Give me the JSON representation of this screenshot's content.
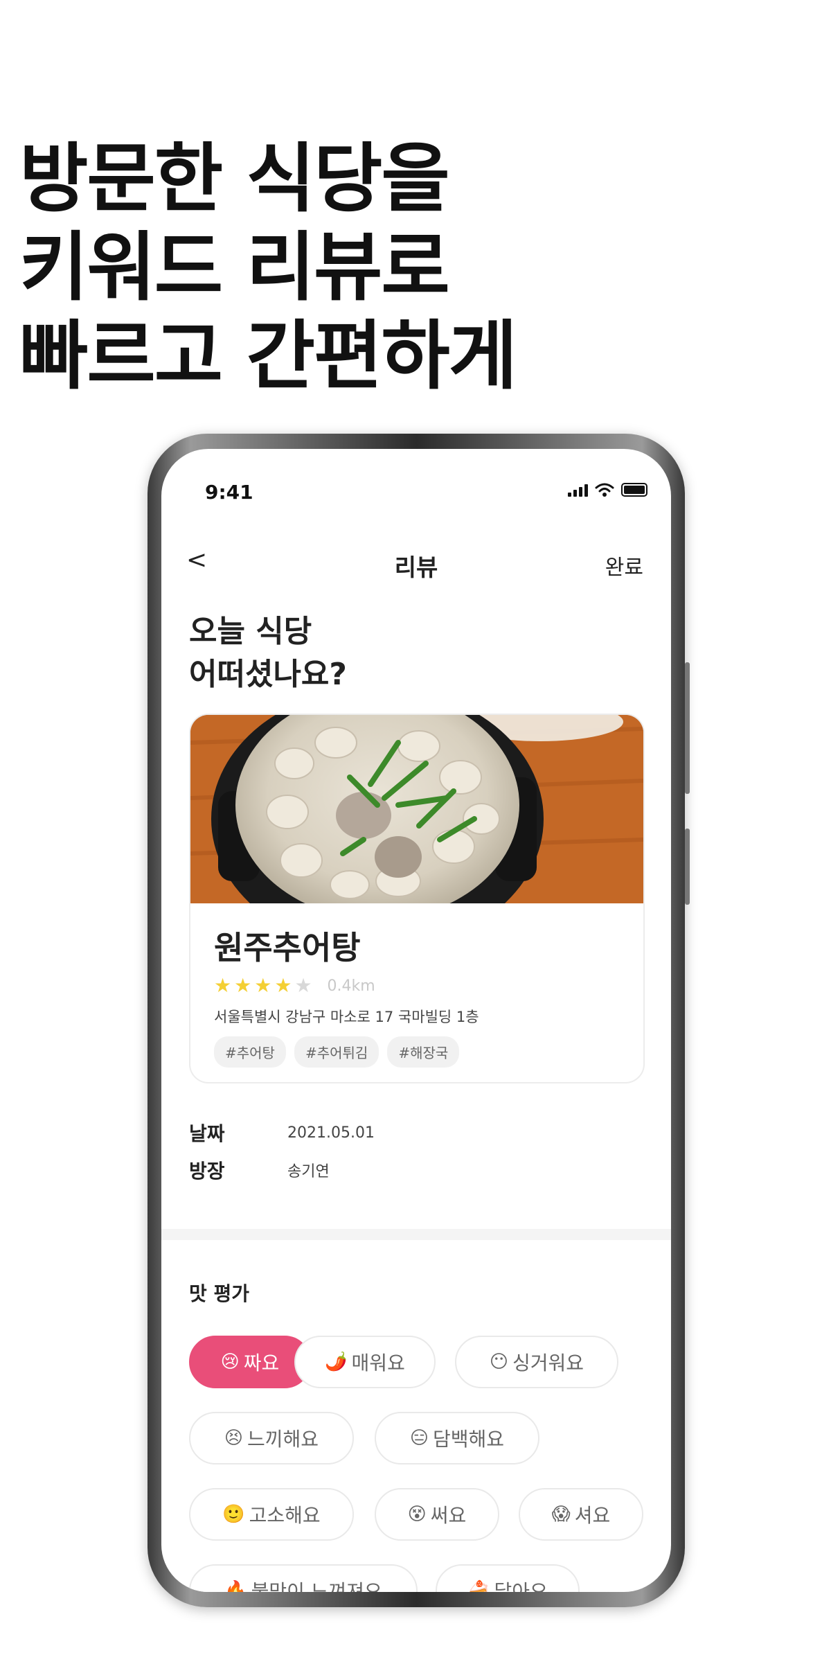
{
  "headline": [
    "방문한 식당을",
    "키워드 리뷰로",
    "빠르고 간편하게"
  ],
  "status": {
    "time": "9:41"
  },
  "nav": {
    "back": "<",
    "title": "리뷰",
    "done": "완료"
  },
  "question": [
    "오늘 식당",
    "어떠셨나요?"
  ],
  "restaurant": {
    "name": "원주추어탕",
    "rating": 4,
    "max_rating": 5,
    "distance": "0.4km",
    "address": "서울특별시 강남구 마소로 17 국마빌딩 1층",
    "tags": [
      "#추어탕",
      "#추어튀김",
      "#해장국"
    ]
  },
  "info": {
    "date_label": "날짜",
    "date_value": "2021.05.01",
    "host_label": "방장",
    "host_value": "송기연"
  },
  "taste": {
    "title": "맛 평가",
    "options": [
      {
        "emoji": "😢",
        "label": "짜요",
        "selected": true
      },
      {
        "emoji": "🌶️",
        "label": "매워요",
        "selected": false
      },
      {
        "emoji": "😶",
        "label": "싱거워요",
        "selected": false
      },
      {
        "emoji": "😣",
        "label": "느끼해요",
        "selected": false
      },
      {
        "emoji": "😑",
        "label": "담백해요",
        "selected": false
      },
      {
        "emoji": "🙂",
        "label": "고소해요",
        "selected": false
      },
      {
        "emoji": "😵",
        "label": "써요",
        "selected": false
      },
      {
        "emoji": "😱",
        "label": "셔요",
        "selected": false
      },
      {
        "emoji": "🔥",
        "label": "불맛이 느껴져요",
        "selected": false
      },
      {
        "emoji": "🍰",
        "label": "달아요",
        "selected": false
      }
    ]
  },
  "colors": {
    "accent": "#e94e79",
    "star": "#f4cf34",
    "star_empty": "#d8d8d8"
  }
}
